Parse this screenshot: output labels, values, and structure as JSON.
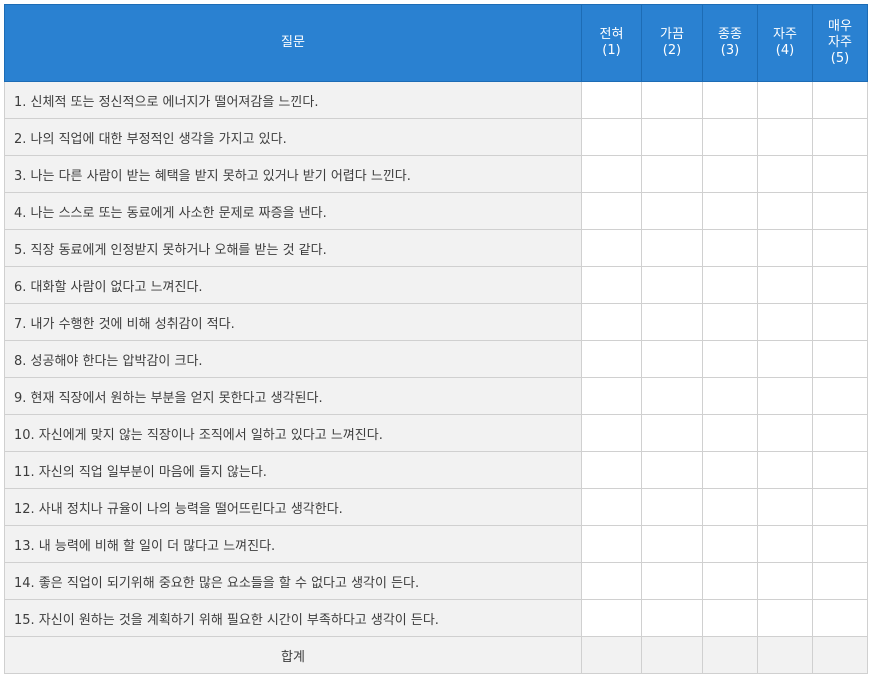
{
  "header": {
    "question_label": "질문",
    "options": [
      {
        "lines": [
          "전혀",
          "(1)"
        ]
      },
      {
        "lines": [
          "가끔",
          "(2)"
        ]
      },
      {
        "lines": [
          "종종",
          "(3)"
        ]
      },
      {
        "lines": [
          "자주",
          "(4)"
        ]
      },
      {
        "lines": [
          "매우",
          "자주",
          "(5)"
        ]
      }
    ]
  },
  "questions": [
    "1. 신체적 또는 정신적으로 에너지가 떨어져감을 느낀다.",
    "2. 나의 직업에 대한 부정적인 생각을 가지고 있다.",
    "3. 나는 다른 사람이 받는 혜택을 받지 못하고 있거나 받기 어렵다 느낀다.",
    "4. 나는 스스로 또는 동료에게 사소한 문제로 짜증을 낸다.",
    "5. 직장 동료에게 인정받지 못하거나 오해를 받는 것 같다.",
    "6. 대화할 사람이 없다고 느껴진다.",
    "7. 내가 수행한 것에 비해 성취감이 적다.",
    "8. 성공해야 한다는 압박감이 크다.",
    "9. 현재 직장에서 원하는 부분을 얻지 못한다고 생각된다.",
    "10. 자신에게 맞지 않는 직장이나 조직에서 일하고 있다고 느껴진다.",
    "11. 자신의 직업 일부분이 마음에 들지 않는다.",
    "12. 사내 정치나 규율이 나의 능력을 떨어뜨린다고 생각한다.",
    "13. 내 능력에 비해 할 일이 더 많다고 느껴진다.",
    "14. 좋은 직업이 되기위해 중요한 많은 요소들을 할 수 없다고 생각이 든다.",
    "15. 자신이 원하는 것을 계획하기 위해 필요한 시간이 부족하다고 생각이 든다."
  ],
  "footer": {
    "total_label": "합계"
  },
  "colors": {
    "header_bg": "#2a81d1",
    "header_text": "#ffffff",
    "question_bg": "#f2f2f2",
    "answer_bg": "#ffffff",
    "border": "#d0d0d0"
  }
}
